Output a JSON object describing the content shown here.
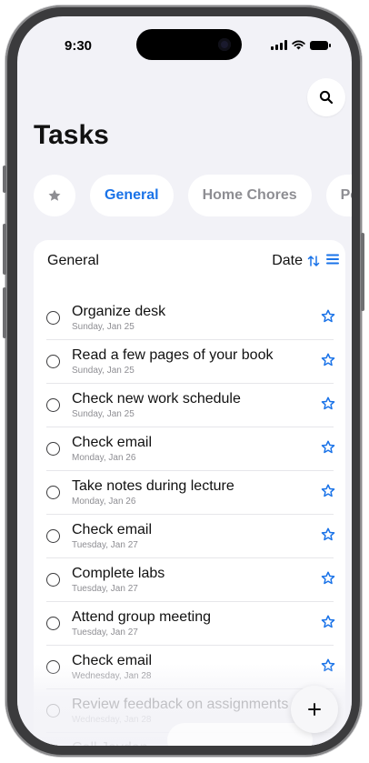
{
  "status": {
    "time": "9:30"
  },
  "header": {
    "title": "Tasks"
  },
  "tabs": [
    {
      "label": "General",
      "active": true
    },
    {
      "label": "Home Chores",
      "active": false
    },
    {
      "label": "Pet",
      "active": false
    }
  ],
  "list": {
    "title": "General",
    "sort_label": "Date",
    "tasks": [
      {
        "title": "Organize desk",
        "date": "Sunday, Jan 25"
      },
      {
        "title": "Read a few pages of your book",
        "date": "Sunday, Jan 25"
      },
      {
        "title": "Check new work schedule",
        "date": "Sunday, Jan 25"
      },
      {
        "title": "Check email",
        "date": "Monday, Jan 26"
      },
      {
        "title": "Take notes during lecture",
        "date": "Monday, Jan 26"
      },
      {
        "title": "Check email",
        "date": "Tuesday, Jan 27"
      },
      {
        "title": "Complete labs",
        "date": "Tuesday, Jan 27"
      },
      {
        "title": "Attend group meeting",
        "date": "Tuesday, Jan 27"
      },
      {
        "title": "Check email",
        "date": "Wednesday, Jan 28"
      },
      {
        "title": "Review feedback on assignments",
        "date": "Wednesday, Jan 28"
      },
      {
        "title": "Call Jayden",
        "date": ""
      }
    ]
  },
  "colors": {
    "accent": "#1a73e8",
    "background": "#f2f2f7",
    "card": "#ffffff",
    "secondary_text": "#8e8e93"
  },
  "icons": {
    "search": "search-icon",
    "favorites": "star-filled-icon",
    "sort": "sort-arrows-icon",
    "menu": "list-menu-icon",
    "task_star": "star-outline-icon",
    "add": "plus-icon"
  }
}
